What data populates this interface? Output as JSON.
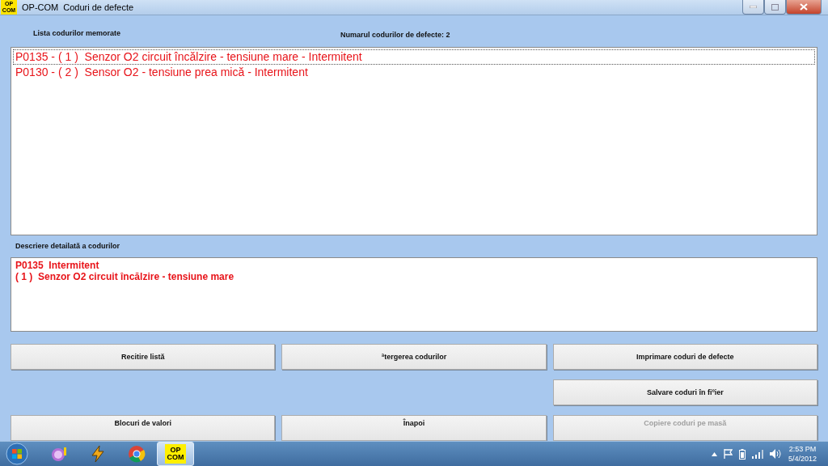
{
  "window": {
    "app_name": "OP-COM",
    "title": "Coduri de defecte",
    "app_icon_lines": [
      "OP",
      "COM"
    ]
  },
  "list_label": "Lista codurilor memorate",
  "count_label": "Numarul codurilor de defecte: 2",
  "codes": [
    {
      "text": "P0135 - ( 1 )  Senzor O2 circuit încălzire - tensiune mare - Intermitent",
      "selected": true
    },
    {
      "text": "P0130 - ( 2 )  Sensor O2 - tensiune prea mică - Intermitent",
      "selected": false
    }
  ],
  "detail_label": "Descriere detailată a codurilor",
  "detail_lines": [
    "P0135  Intermitent",
    "( 1 )  Senzor O2 circuit încălzire - tensiune mare"
  ],
  "button_rows": [
    [
      {
        "label": "Recitire listă",
        "disabled": false
      },
      {
        "label": "ªtergerea codurilor",
        "disabled": false
      },
      {
        "label": "Imprimare coduri de defecte",
        "disabled": false
      }
    ],
    [
      null,
      null,
      {
        "label": "Salvare coduri în fiºier",
        "disabled": false
      }
    ],
    [
      {
        "label": "Blocuri de valori",
        "disabled": false
      },
      {
        "label": "Înapoi",
        "disabled": false
      },
      {
        "label": "Copiere coduri pe masă",
        "disabled": true
      }
    ]
  ],
  "taskbar": {
    "items": [
      {
        "kind": "messenger",
        "selected": false
      },
      {
        "kind": "winamp",
        "selected": false
      },
      {
        "kind": "chrome",
        "selected": false
      },
      {
        "kind": "opcom",
        "selected": true,
        "lines": [
          "OP",
          "COM"
        ]
      }
    ],
    "time": "2:53 PM",
    "date": "5/4/2012"
  }
}
